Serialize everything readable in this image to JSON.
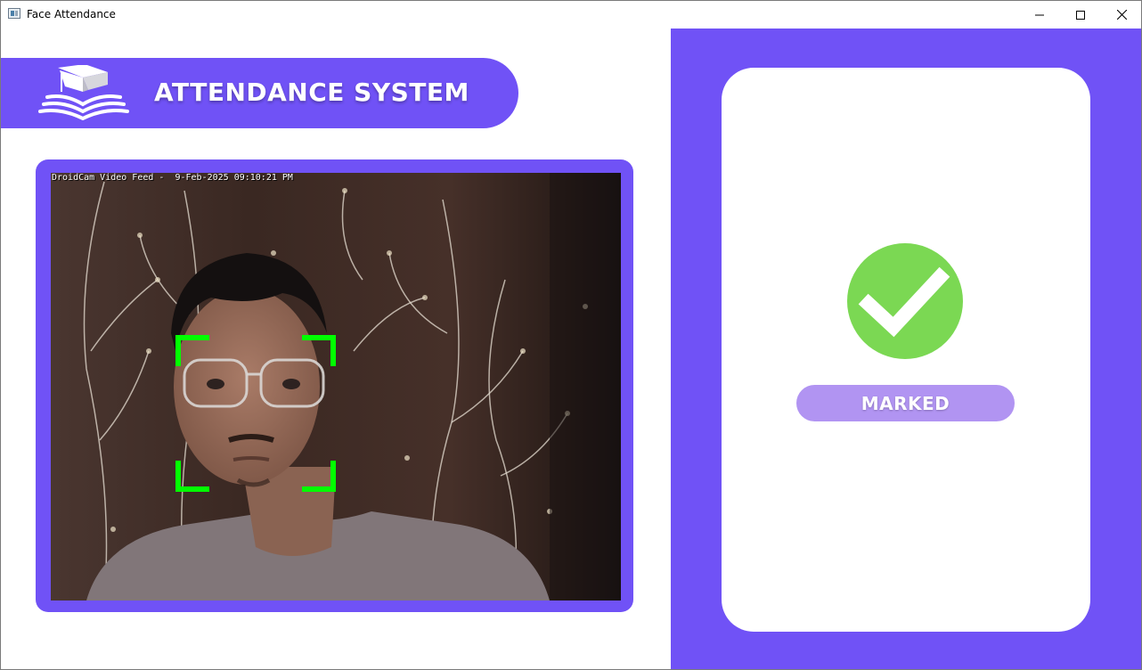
{
  "window": {
    "title": "Face Attendance",
    "icon": "app-window-icon",
    "controls": [
      "minimize-icon",
      "maximize-icon",
      "close-icon"
    ]
  },
  "header": {
    "title": "ATTENDANCE SYSTEM",
    "logo_icon": "graduation-cap-book-icon",
    "color": "#7052f6"
  },
  "video": {
    "overlay_text": "DroidCam Video Feed -  9-Feb-2025 09:10:21 PM",
    "face_box_color": "#00ff00"
  },
  "status": {
    "icon": "check-circle-icon",
    "label": "MARKED",
    "icon_color": "#7bd853",
    "pill_color": "#b194f2"
  },
  "colors": {
    "accent": "#7052f6",
    "background": "#ffffff"
  }
}
